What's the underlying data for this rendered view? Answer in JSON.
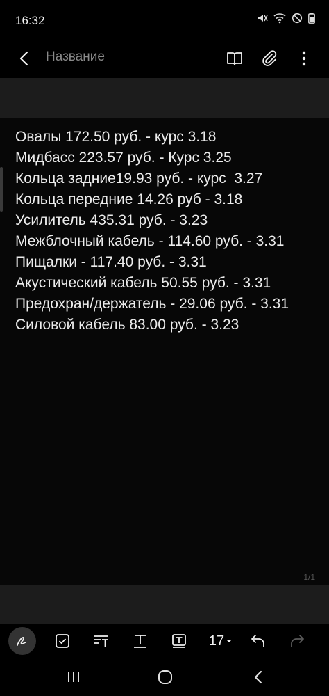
{
  "status": {
    "time": "16:32"
  },
  "appbar": {
    "title_placeholder": "Название"
  },
  "note_lines": [
    "Овалы 172.50 руб. - курс 3.18",
    "Мидбасс 223.57 руб. - Курс 3.25",
    "Кольца задние19.93 руб. - курс  3.27",
    "Кольца передние 14.26 руб - 3.18",
    "Усилитель 435.31 руб. - 3.23",
    "Межблочный кабель - 114.60 руб. - 3.31",
    "Пищалки - 117.40 руб. - 3.31",
    "Акустический кабель 50.55 руб. - 3.31",
    "Предохран/держатель - 29.06 руб. - 3.31",
    "Силовой кабель 83.00 руб. - 3.23"
  ],
  "page_indicator": "1/1",
  "toolbar": {
    "font_size": "17"
  },
  "icons": [
    "mute-icon",
    "wifi-icon",
    "do-not-disturb-icon",
    "battery-icon",
    "back-icon",
    "reading-mode-icon",
    "attach-icon",
    "more-icon",
    "pen-icon",
    "checkbox-icon",
    "text-style-icon",
    "text-format-icon",
    "text-highlight-icon",
    "undo-icon",
    "redo-icon",
    "recent-apps-icon",
    "home-icon",
    "back-nav-icon"
  ],
  "colors": {
    "background": "#000000",
    "band": "#1c1c1c",
    "text": "#ececec",
    "placeholder": "#8a8a8a"
  }
}
